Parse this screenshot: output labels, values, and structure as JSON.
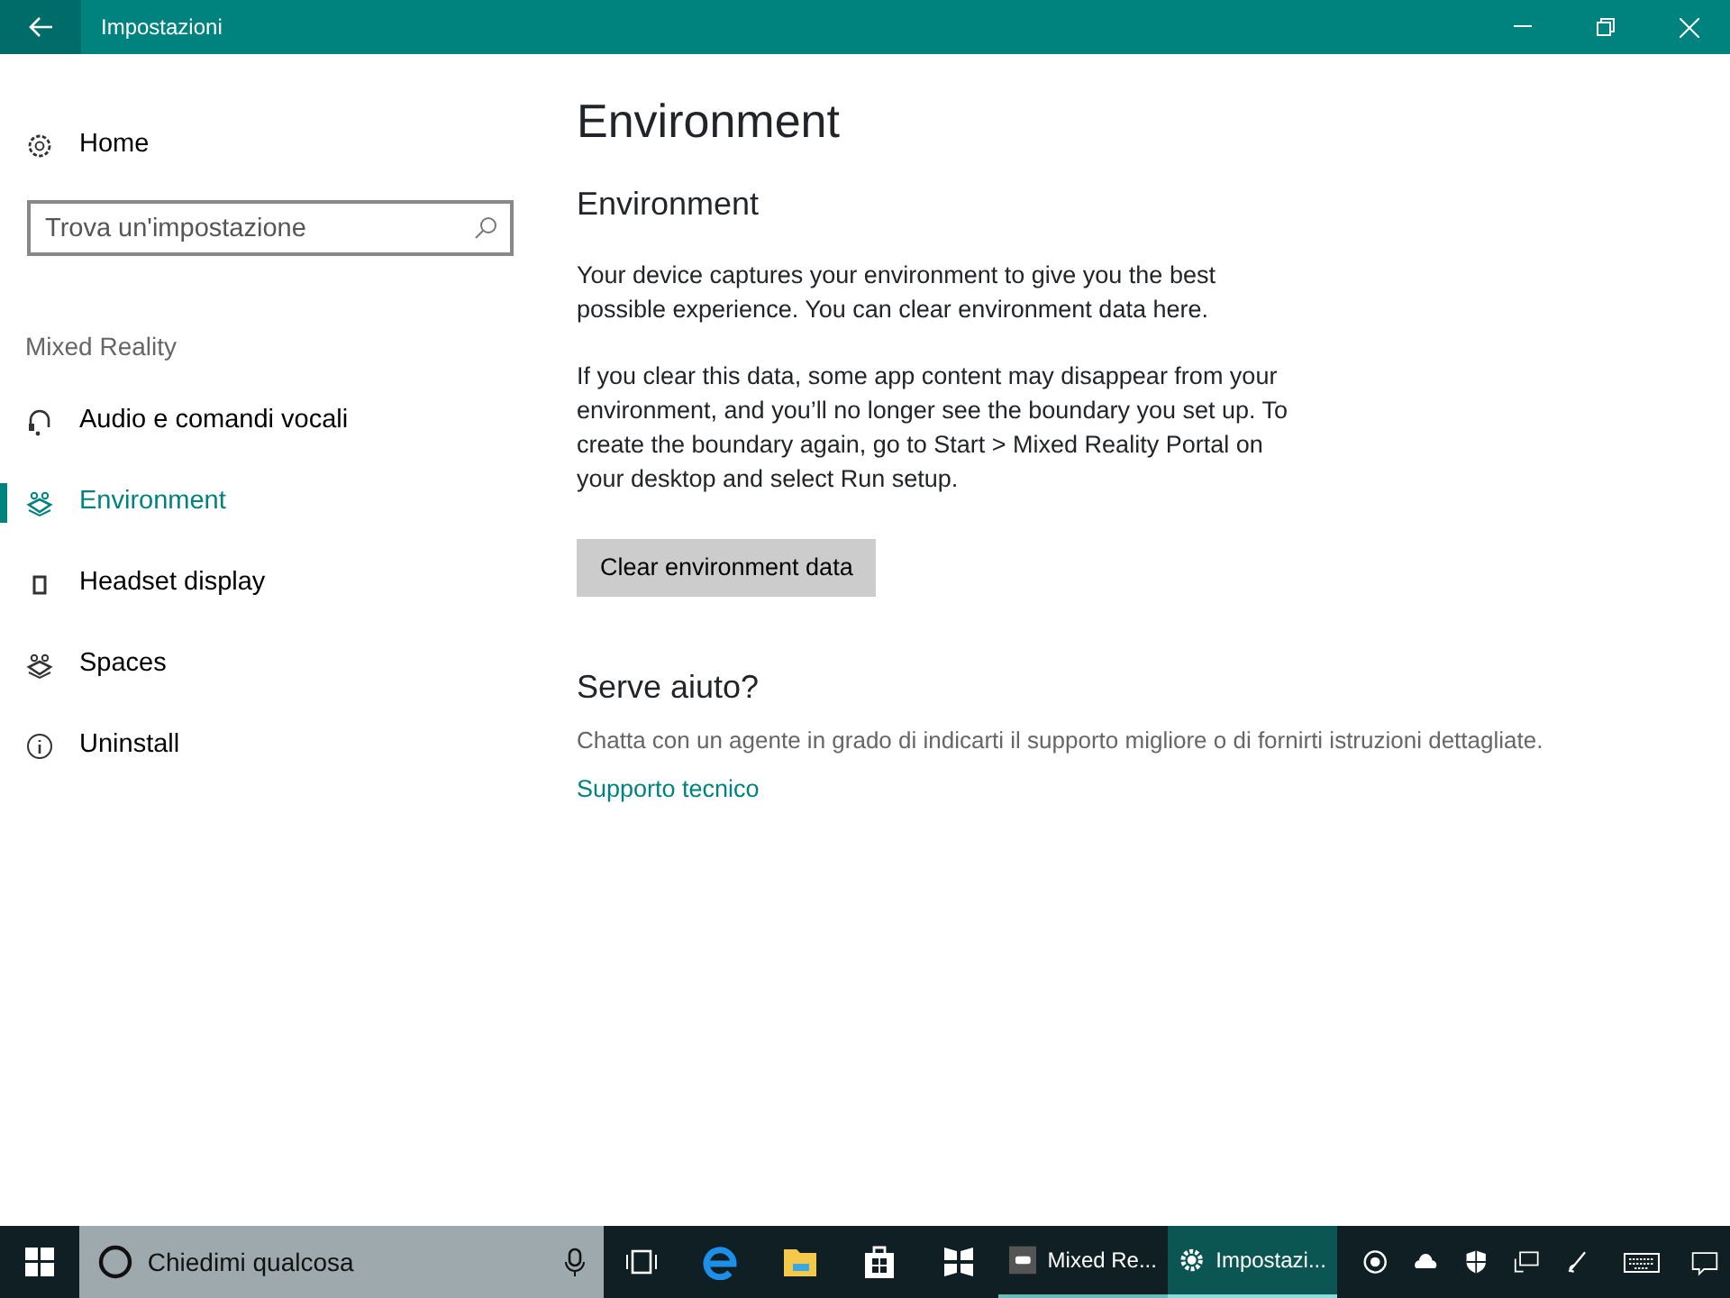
{
  "window": {
    "title": "Impostazioni"
  },
  "sidebar": {
    "home": "Home",
    "search": {
      "placeholder": "Trova un'impostazione"
    },
    "section": "Mixed Reality",
    "items": [
      {
        "label": "Audio e comandi vocali",
        "selected": false
      },
      {
        "label": "Environment",
        "selected": true
      },
      {
        "label": "Headset display",
        "selected": false
      },
      {
        "label": "Spaces",
        "selected": false
      },
      {
        "label": "Uninstall",
        "selected": false
      }
    ]
  },
  "content": {
    "page_title": "Environment",
    "section_title": "Environment",
    "paragraphs": [
      "Your device captures your environment to give you the best possible experience. You can clear environment data here.",
      "If you clear this data, some app content may disappear from your environment, and you’ll no longer see the boundary you set up. To create the boundary again, go to Start > Mixed Reality Portal on your desktop and select Run setup."
    ],
    "button": "Clear environment data",
    "help": {
      "title": "Serve aiuto?",
      "text": "Chatta con un agente in grado di indicarti il supporto migliore o di fornirti istruzioni dettagliate.",
      "link": "Supporto tecnico"
    }
  },
  "taskbar": {
    "search": "Chiedimi qualcosa",
    "apps": [
      {
        "label": "Mixed Re...",
        "selected": false
      },
      {
        "label": "Impostazi...",
        "selected": true
      }
    ]
  }
}
